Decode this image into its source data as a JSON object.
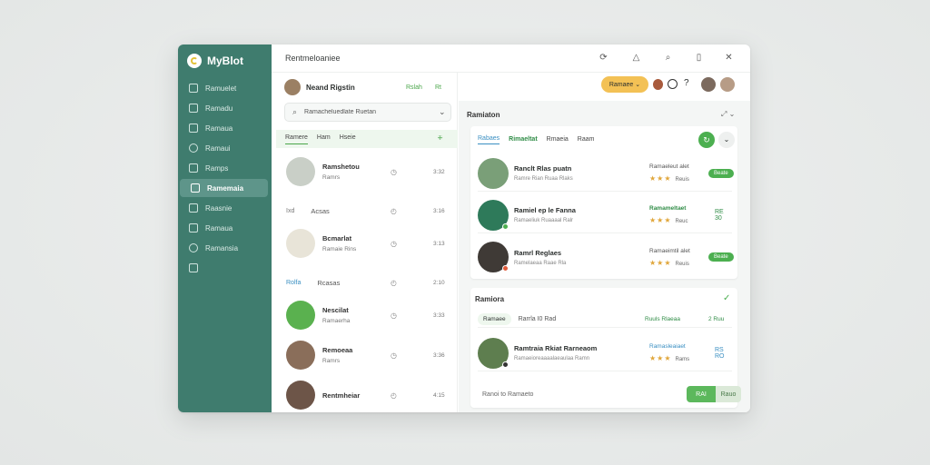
{
  "app": {
    "name": "MyBlot",
    "window_title": "Rentmeloaniee"
  },
  "colors": {
    "sidebar": "#3f7c6e",
    "accent_green": "#4caf50",
    "accent_orange": "#f3c155",
    "accent_blue": "#3a8fc2"
  },
  "sidebar": {
    "items": [
      {
        "label": "Ramuelet",
        "icon": "grid-icon"
      },
      {
        "label": "Ramadu",
        "icon": "list-icon"
      },
      {
        "label": "Ramaua",
        "icon": "square-icon"
      },
      {
        "label": "Ramaui",
        "icon": "check-circle-icon"
      },
      {
        "label": "Ramps",
        "icon": "table-icon"
      },
      {
        "label": "Ramemaia",
        "icon": "profile-icon"
      },
      {
        "label": "Raasnie",
        "icon": "chat-icon"
      },
      {
        "label": "Ramaua",
        "icon": "lock-icon"
      },
      {
        "label": "Ramansia",
        "icon": "settings-icon"
      },
      {
        "label": "",
        "icon": "tv-icon"
      }
    ]
  },
  "topbar": {
    "icons": [
      "refresh-icon",
      "bell-icon",
      "search-icon",
      "clipboard-icon",
      "close-icon"
    ]
  },
  "user": {
    "name": "Neand Rigstin",
    "link": "Rslah",
    "link_icon": "Rt"
  },
  "search": {
    "value": "Ramacheluedlate Ruetan"
  },
  "list_tabs": [
    "Ramere",
    "Ham",
    "Hseie"
  ],
  "list_items": [
    {
      "title": "Ramshetou",
      "sub": "Ramrs",
      "num": "3:32",
      "kind": "avatar",
      "color": "#c9cfc7"
    },
    {
      "title": "Acsas",
      "sub": "",
      "num": "3:16",
      "kind": "icon",
      "prefix": "Ixd"
    },
    {
      "title": "Bcmarlat",
      "sub": "Ramaie Rins",
      "num": "3:13",
      "kind": "avatar",
      "color": "#e8e4d8"
    },
    {
      "title": "Rcasas",
      "sub": "",
      "num": "2:10",
      "kind": "icon",
      "prefix": "Rolfa"
    },
    {
      "title": "Nescilat",
      "sub": "Ramaerha",
      "num": "3:33",
      "kind": "avatar",
      "color": "#5ab14f"
    },
    {
      "title": "Remoeaa",
      "sub": "Ramrs",
      "num": "3:36",
      "kind": "avatar",
      "color": "#8a6e5a"
    },
    {
      "title": "Rentmheiar",
      "sub": "",
      "num": "4:15",
      "kind": "avatar",
      "color": "#6d5548"
    }
  ],
  "right": {
    "panel_title": "Ramiaton",
    "card1": {
      "tabs": [
        "Rabaes",
        "Rimaeltat",
        "Rmaeia",
        "Raam"
      ],
      "rows": [
        {
          "title": "Ranclt Rlas puatn",
          "sub": "Ramre Rian Ruaa Rlaks",
          "label": "Ramaeleut alet",
          "label_color": "#555",
          "rating": "★★★",
          "rating_text": "Reuis",
          "pill": "Beate",
          "thumb": "#7a9f78"
        },
        {
          "title": "Ramiel ep le Fanna",
          "sub": "Ramaeliuk Ruaaaal Ralr",
          "label": "Ramameltaet",
          "label_color": "#2f8c46",
          "rating": "★★★",
          "rating_text": "Reuc",
          "pill": "",
          "value": "RE 30",
          "thumb": "#2e7a5a"
        },
        {
          "title": "Ramrl Reglaes",
          "sub": "Ramelaeaa Raae Rla",
          "label": "Ramaeimtil alet",
          "label_color": "#555",
          "rating": "★★★",
          "rating_text": "Reuis",
          "pill": "Beate",
          "thumb": "#3f3a36"
        }
      ]
    },
    "card2": {
      "title": "Ramiora",
      "filter_chip": "Ramaee",
      "filter_text": "Rarrla I0 Rad",
      "filter_right": "Ruuls Rlaeaa",
      "filter_right_num": "2 Ruu",
      "row": {
        "title": "Ramtraia Rkiat Rarneaom",
        "sub": "Ramaeioreaaaalaeaulaa Ramn",
        "label": "Ramasleaiaet",
        "label_color": "#3a8fc2",
        "rating": "★★★",
        "rating_text": "Rams",
        "value": "RS RO",
        "thumb": "#5e7e4f"
      },
      "footer_text": "Ranoi to Ramaeto",
      "footer_btn": "RAI",
      "footer_btn2": "Rauo"
    }
  },
  "header_pill": "Ramaee"
}
